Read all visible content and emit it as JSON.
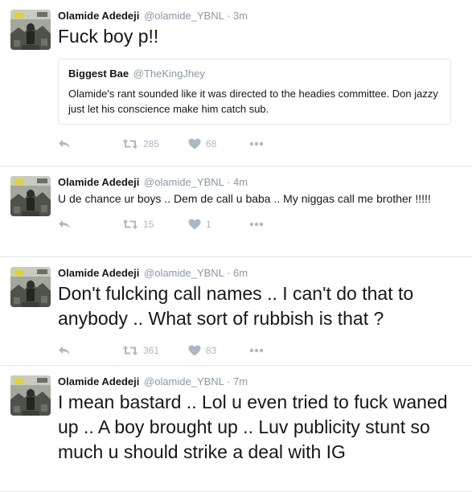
{
  "tweets": [
    {
      "name": "Olamide Adedeji",
      "handle": "@olamide_YBNL",
      "dot": "·",
      "time": "3m",
      "text": "Fuck boy p!!",
      "quote": {
        "name": "Biggest Bae",
        "handle": "@TheKingJhey",
        "text": "Olamide's rant sounded like it was directed to the headies committee. Don jazzy just let his conscience make him catch sub."
      },
      "retweets": "285",
      "likes": "68"
    },
    {
      "name": "Olamide Adedeji",
      "handle": "@olamide_YBNL",
      "dot": "·",
      "time": "4m",
      "text": "U de chance ur boys .. Dem de call u baba .. My niggas call me brother !!!!!",
      "retweets": "15",
      "likes": "1"
    },
    {
      "name": "Olamide Adedeji",
      "handle": "@olamide_YBNL",
      "dot": "·",
      "time": "6m",
      "text": "Don't fulcking call names .. I can't do that to anybody .. What sort of rubbish is that ?",
      "retweets": "361",
      "likes": "83"
    },
    {
      "name": "Olamide Adedeji",
      "handle": "@olamide_YBNL",
      "dot": "·",
      "time": "7m",
      "text": "I mean bastard .. Lol u even tried to fuck waned up .. A boy brought up .. Luv publicity stunt so much u should strike a deal with IG"
    }
  ],
  "icons": {
    "reply": "reply-icon",
    "retweet": "retweet-icon",
    "like": "heart-icon",
    "more": "more-dots-icon"
  },
  "colors": {
    "text": "#14171a",
    "muted": "#8899a6",
    "icon": "#aab8c2",
    "border": "#e1e8ed"
  }
}
